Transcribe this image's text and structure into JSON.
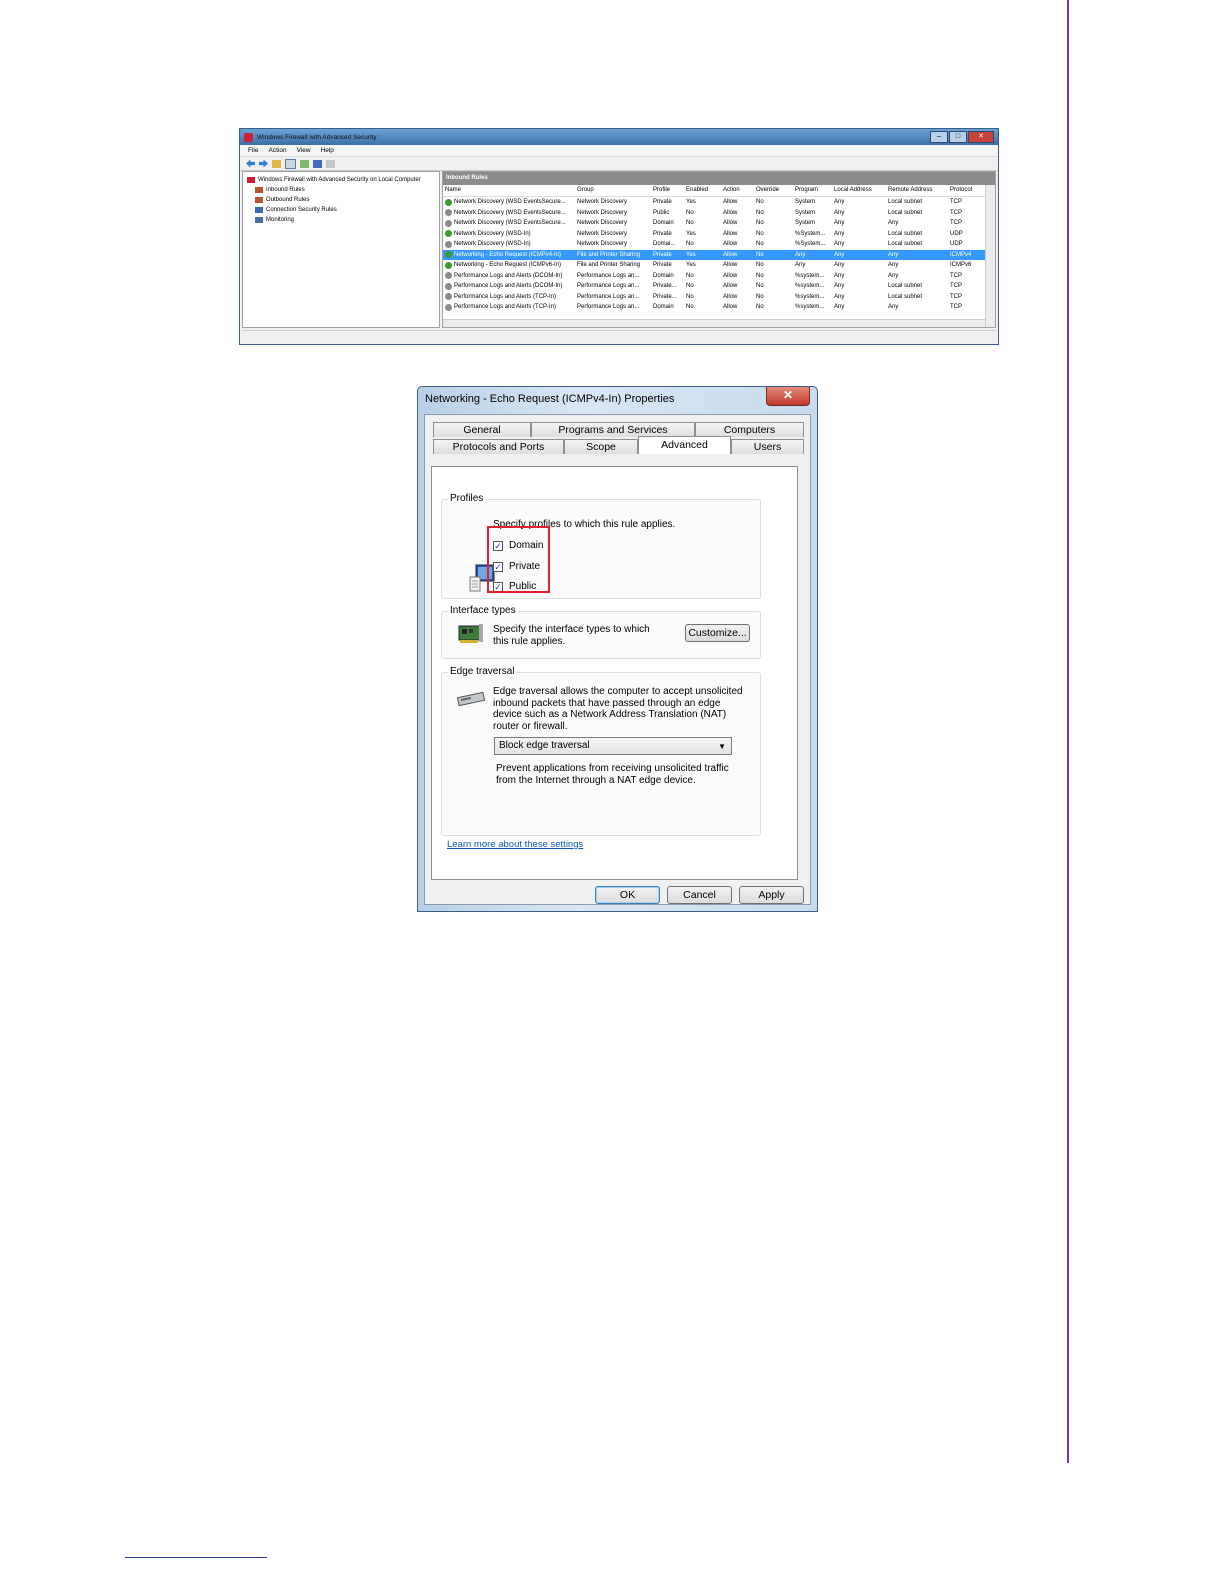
{
  "firewall": {
    "title": "Windows Firewall with Advanced Security",
    "menu": [
      "File",
      "Action",
      "View",
      "Help"
    ],
    "tree": [
      {
        "label": "Windows Firewall with Advanced Security on Local Computer",
        "icon": "firewall-icon"
      },
      {
        "label": "Inbound Rules",
        "icon": "inbound-rules-icon"
      },
      {
        "label": "Outbound Rules",
        "icon": "outbound-rules-icon"
      },
      {
        "label": "Connection Security Rules",
        "icon": "connection-security-icon"
      },
      {
        "label": "Monitoring",
        "icon": "monitoring-icon"
      }
    ],
    "panel_header": "Inbound Rules",
    "columns": [
      "Name",
      "Group",
      "Profile",
      "Enabled",
      "Action",
      "Override",
      "Program",
      "Local Address",
      "Remote Address",
      "Protocol"
    ],
    "rows": [
      {
        "enabled_icon": "on",
        "cells": [
          "Network Discovery (WSD EventsSecure...",
          "Network Discovery",
          "Private",
          "Yes",
          "Allow",
          "No",
          "System",
          "Any",
          "Local subnet",
          "TCP"
        ]
      },
      {
        "enabled_icon": "off",
        "cells": [
          "Network Discovery (WSD EventsSecure...",
          "Network Discovery",
          "Public",
          "No",
          "Allow",
          "No",
          "System",
          "Any",
          "Local subnet",
          "TCP"
        ]
      },
      {
        "enabled_icon": "off",
        "cells": [
          "Network Discovery (WSD EventsSecure...",
          "Network Discovery",
          "Domain",
          "No",
          "Allow",
          "No",
          "System",
          "Any",
          "Any",
          "TCP"
        ]
      },
      {
        "enabled_icon": "on",
        "cells": [
          "Network Discovery (WSD-In)",
          "Network Discovery",
          "Private",
          "Yes",
          "Allow",
          "No",
          "%System...",
          "Any",
          "Local subnet",
          "UDP"
        ]
      },
      {
        "enabled_icon": "off",
        "cells": [
          "Network Discovery (WSD-In)",
          "Network Discovery",
          "Domai...",
          "No",
          "Allow",
          "No",
          "%System...",
          "Any",
          "Local subnet",
          "UDP"
        ]
      },
      {
        "enabled_icon": "on",
        "selected": true,
        "cells": [
          "Networking - Echo Request (ICMPv4-In)",
          "File and Printer Sharing",
          "Private",
          "Yes",
          "Allow",
          "No",
          "Any",
          "Any",
          "Any",
          "ICMPv4"
        ]
      },
      {
        "enabled_icon": "on",
        "cells": [
          "Networking - Echo Request (ICMPv6-In)",
          "File and Printer Sharing",
          "Private",
          "Yes",
          "Allow",
          "No",
          "Any",
          "Any",
          "Any",
          "ICMPv6"
        ]
      },
      {
        "enabled_icon": "off",
        "cells": [
          "Performance Logs and Alerts (DCOM-In)",
          "Performance Logs an...",
          "Domain",
          "No",
          "Allow",
          "No",
          "%system...",
          "Any",
          "Any",
          "TCP"
        ]
      },
      {
        "enabled_icon": "off",
        "cells": [
          "Performance Logs and Alerts (DCOM-In)",
          "Performance Logs an...",
          "Private...",
          "No",
          "Allow",
          "No",
          "%system...",
          "Any",
          "Local subnet",
          "TCP"
        ]
      },
      {
        "enabled_icon": "off",
        "cells": [
          "Performance Logs and Alerts (TCP-In)",
          "Performance Logs an...",
          "Private...",
          "No",
          "Allow",
          "No",
          "%system...",
          "Any",
          "Local subnet",
          "TCP"
        ]
      },
      {
        "enabled_icon": "off",
        "cells": [
          "Performance Logs and Alerts (TCP-In)",
          "Performance Logs an...",
          "Domain",
          "No",
          "Allow",
          "No",
          "%system...",
          "Any",
          "Any",
          "TCP"
        ]
      }
    ]
  },
  "dialog": {
    "title": "Networking - Echo Request (ICMPv4-In) Properties",
    "close_glyph": "✕",
    "tabs_row1": [
      "General",
      "Programs and Services",
      "Computers"
    ],
    "tabs_row2": [
      "Protocols and Ports",
      "Scope",
      "Advanced",
      "Users"
    ],
    "active_tab": "Advanced",
    "profiles": {
      "label": "Profiles",
      "description": "Specify profiles to which this rule applies.",
      "options": [
        {
          "label": "Domain",
          "checked": true
        },
        {
          "label": "Private",
          "checked": true
        },
        {
          "label": "Public",
          "checked": true
        }
      ]
    },
    "interface_types": {
      "label": "Interface types",
      "description": "Specify the interface types to which this rule applies.",
      "button": "Customize..."
    },
    "edge_traversal": {
      "label": "Edge traversal",
      "description": "Edge traversal allows the computer to accept unsolicited inbound packets that have passed through an edge device such as a Network Address Translation (NAT) router or firewall.",
      "selected": "Block edge traversal",
      "help": "Prevent applications from receiving unsolicited traffic from the Internet through a NAT edge device."
    },
    "learn_more": "Learn more about these settings",
    "buttons": {
      "ok": "OK",
      "cancel": "Cancel",
      "apply": "Apply"
    }
  },
  "colors": {
    "accent_rule": "#7b2fbe",
    "highlight_box": "#e0202a",
    "selection": "#3399ff",
    "link": "#0a58b6"
  }
}
